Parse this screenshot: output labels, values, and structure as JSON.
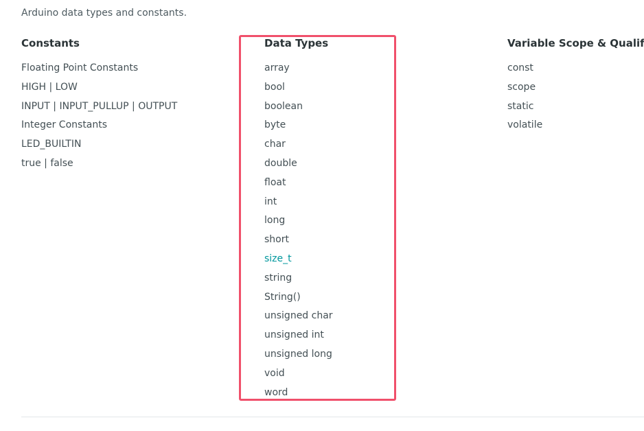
{
  "intro": "Arduino data types and constants.",
  "columns": {
    "constants": {
      "title": "Constants",
      "items": [
        "Floating Point Constants",
        "HIGH | LOW",
        "INPUT | INPUT_PULLUP | OUTPUT",
        "Integer Constants",
        "LED_BUILTIN",
        "true | false"
      ]
    },
    "data_types": {
      "title": "Data Types",
      "items": [
        "array",
        "bool",
        "boolean",
        "byte",
        "char",
        "double",
        "float",
        "int",
        "long",
        "short",
        "size_t",
        "string",
        "String()",
        "unsigned char",
        "unsigned int",
        "unsigned long",
        "void",
        "word"
      ],
      "highlighted_item": "size_t"
    },
    "variable_scope": {
      "title": "Variable Scope & Qualifiers",
      "items": [
        "const",
        "scope",
        "static",
        "volatile"
      ]
    }
  },
  "colors": {
    "highlight_box": "#f0506b",
    "link_highlight": "#00979d",
    "text": "#434f54",
    "heading": "#2b3437"
  }
}
